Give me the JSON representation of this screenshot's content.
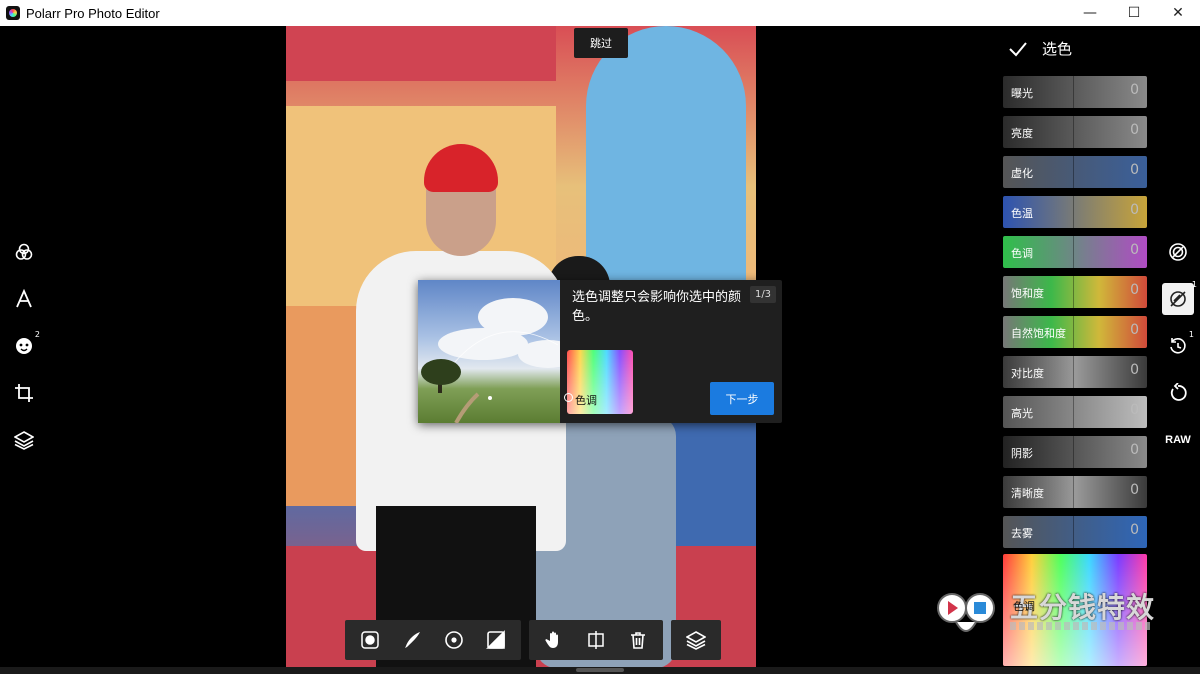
{
  "window": {
    "title": "Polarr Pro Photo Editor",
    "controls": [
      "—",
      "☐",
      "✕"
    ]
  },
  "left_tools": [
    {
      "name": "filters-icon"
    },
    {
      "name": "text-icon"
    },
    {
      "name": "face-icon",
      "badge": "2"
    },
    {
      "name": "crop-icon"
    },
    {
      "name": "layers-icon"
    }
  ],
  "overlay": {
    "skip_label": "跳过"
  },
  "tutorial": {
    "text": "选色调整只会影响你选中的颜色。",
    "page": "1/3",
    "hue_label": "色调",
    "next_label": "下一步"
  },
  "panel": {
    "title": "选色",
    "sliders": [
      {
        "label": "曝光",
        "value": "0",
        "bg": "linear-gradient(90deg,#2b2b2b,#8a8a8a)"
      },
      {
        "label": "亮度",
        "value": "0",
        "bg": "linear-gradient(90deg,#2b2b2b,#8a8a8a)"
      },
      {
        "label": "虚化",
        "value": "0",
        "bg": "linear-gradient(90deg,#555,#3a5f9a)"
      },
      {
        "label": "色温",
        "value": "0",
        "bg": "linear-gradient(90deg,#2d53b0,#c8a43a)"
      },
      {
        "label": "色调",
        "value": "0",
        "bg": "linear-gradient(90deg,#2fbf4a,#b04cc4)"
      },
      {
        "label": "饱和度",
        "value": "0",
        "bg": "linear-gradient(90deg,#777,#3cb84a,#d0b83a,#d04a3a)"
      },
      {
        "label": "自然饱和度",
        "value": "0",
        "bg": "linear-gradient(90deg,#777,#3cb84a,#d0b83a,#d04a3a)"
      },
      {
        "label": "对比度",
        "value": "0",
        "bg": "linear-gradient(90deg,#3a3a3a,#9a9a9a,#3a3a3a)"
      },
      {
        "label": "高光",
        "value": "0",
        "bg": "linear-gradient(90deg,#555,#bdbdbd)"
      },
      {
        "label": "阴影",
        "value": "0",
        "bg": "linear-gradient(90deg,#222,#8a8a8a)"
      },
      {
        "label": "清晰度",
        "value": "0",
        "bg": "linear-gradient(90deg,#3a3a3a,#9a9a9a,#3a3a3a)"
      },
      {
        "label": "去雾",
        "value": "0",
        "bg": "linear-gradient(90deg,#555,#2e66b8)"
      }
    ],
    "hue_wheel_label": "色调"
  },
  "right_tools": [
    {
      "name": "adjust-icon"
    },
    {
      "name": "selective-color-icon",
      "badge": "1",
      "active": true
    },
    {
      "name": "history-icon",
      "badge": "1"
    },
    {
      "name": "reset-icon"
    },
    {
      "name": "raw-label",
      "text": "RAW"
    }
  ],
  "watermark": {
    "text": "五分钱特效"
  }
}
